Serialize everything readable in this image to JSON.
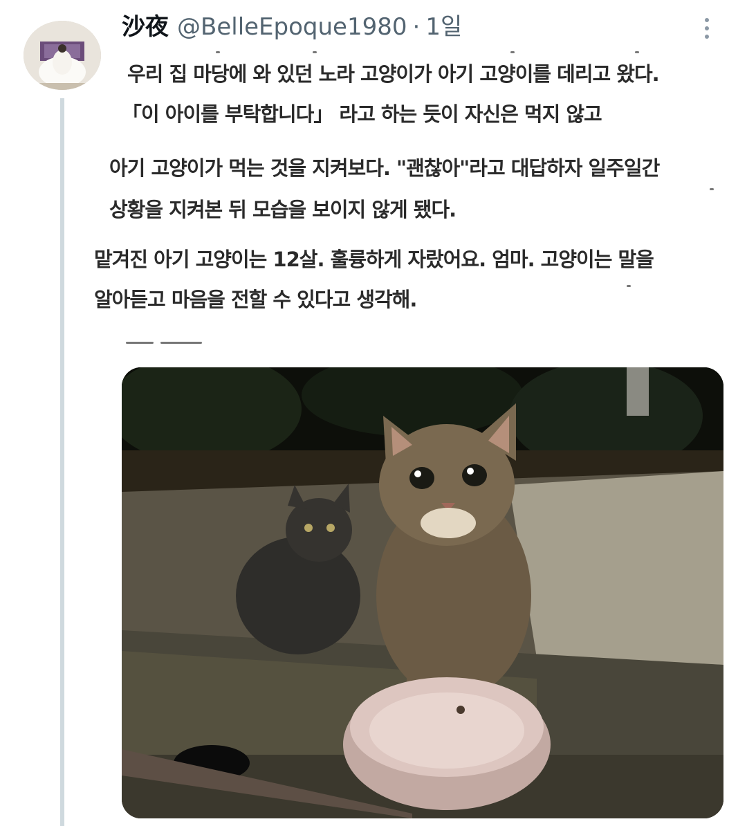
{
  "tweet": {
    "display_name": "沙夜",
    "handle": "@BelleEpoque1980",
    "separator": "·",
    "time": "1일",
    "more_icon": "more-vertical-icon"
  },
  "image_text": {
    "line1": "우리 집 마당에 와 있던 노라 고양이가 아기 고양이를 데리고 왔다.",
    "line2": "「이 아이를 부탁합니다」 라고 하는 듯이 자신은 먹지 않고",
    "line3": "아기 고양이가 먹는 것을 지켜보다. \"괜찮아\"라고 대답하자 일주일간",
    "line4": "상황을 지켜본 뒤 모습을 보이지 않게 됐다.",
    "line5": "맡겨진 아기 고양이는 12살. 훌륭하게 자랐어요. 엄마. 고양이는 말을",
    "line6": "알아듣고 마음을 전할 수 있다고 생각해."
  },
  "photo": {
    "description_icon": "cats-photo"
  }
}
